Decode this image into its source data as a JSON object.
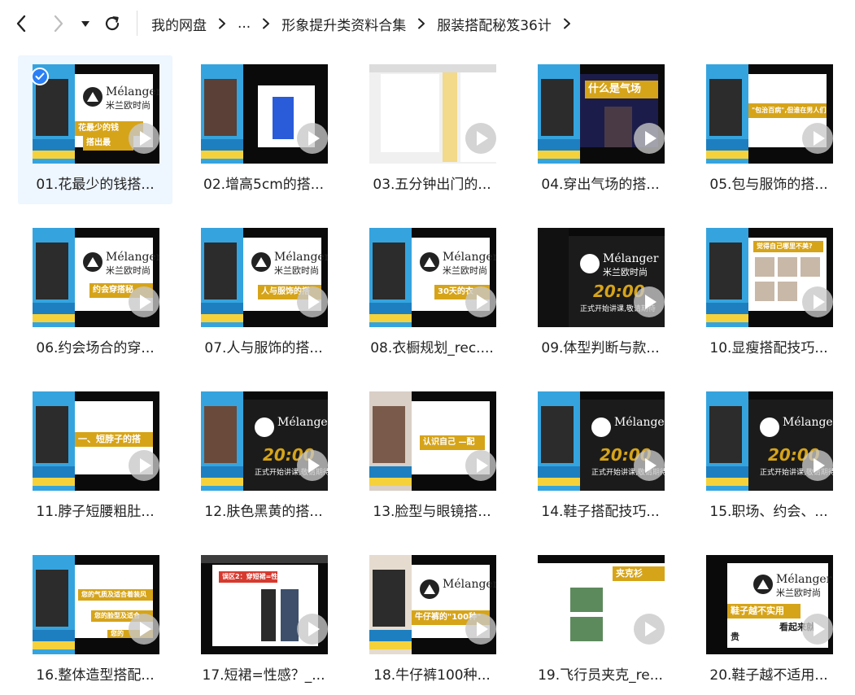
{
  "nav": {
    "breadcrumb": [
      "我的网盘",
      "...",
      "形象提升类资料合集",
      "服装搭配秘笈36计"
    ]
  },
  "thumb_text": {
    "brand": "Mélanger",
    "brand_cn": "米兰欧时尚",
    "time": "20:00",
    "start": "正式开始讲课,敬请期待",
    "t01": "花最少的钱",
    "t01b": "搭出最",
    "t04": "什么是气场",
    "t05": "\"包治百病\",但谁在男人们眼中...",
    "t06": "约会穿搭秘",
    "t07": "人与服饰的搭",
    "t08": "30天的衣",
    "t10": "觉得自己哪里不美?",
    "t11": "一、短脖子的搭",
    "t13": "认识自己 —配",
    "t16a": "您的气质及适合着装风",
    "t16b": "您的脸型及适合",
    "t16c": "您的",
    "t17": "误区2：穿短裙=性感",
    "t18": "牛仔裤的\"100种\"",
    "t19": "夹克衫",
    "t20a": "鞋子越不实用",
    "t20b": "看起来就",
    "t20c": "贵"
  },
  "files": [
    {
      "label": "01.花最少的钱搭...",
      "selected": true
    },
    {
      "label": "02.增高5cm的搭..."
    },
    {
      "label": "03.五分钟出门的..."
    },
    {
      "label": "04.穿出气场的搭..."
    },
    {
      "label": "05.包与服饰的搭..."
    },
    {
      "label": "06.约会场合的穿..."
    },
    {
      "label": "07.人与服饰的搭..."
    },
    {
      "label": "08.衣橱规划_rec...."
    },
    {
      "label": "09.体型判断与款..."
    },
    {
      "label": "10.显瘦搭配技巧..."
    },
    {
      "label": "11.脖子短腰粗肚..."
    },
    {
      "label": "12.肤色黑黄的搭..."
    },
    {
      "label": "13.脸型与眼镜搭..."
    },
    {
      "label": "14.鞋子搭配技巧..."
    },
    {
      "label": "15.职场、约会、..."
    },
    {
      "label": "16.整体造型搭配..."
    },
    {
      "label": "17.短裙=性感？_..."
    },
    {
      "label": "18.牛仔裤100种..."
    },
    {
      "label": "19.飞行员夹克_re..."
    },
    {
      "label": "20.鞋子越不适用..."
    }
  ],
  "colors": {
    "accent": "#2a7ff5",
    "selected_bg": "#eef6ff",
    "gold": "#d6a419",
    "panel_blue": "#35a4de"
  }
}
